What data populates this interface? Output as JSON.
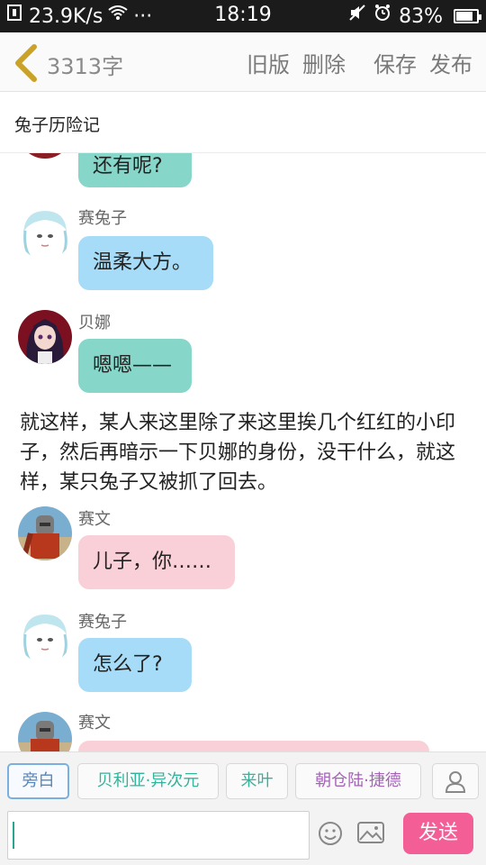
{
  "status_bar": {
    "net_speed": "23.9K/s",
    "dots": "···",
    "time": "18:19",
    "battery": "83%",
    "battery_level": 0.83
  },
  "toolbar": {
    "word_count": "3313字",
    "old_version": "旧版",
    "delete": "删除",
    "save": "保存",
    "publish": "发布"
  },
  "story": {
    "title": "兔子历险记"
  },
  "messages": [
    {
      "type": "bubble",
      "speaker": "",
      "text": "还有呢?",
      "color": "#86d7c9"
    },
    {
      "type": "bubble",
      "speaker": "赛兔子",
      "text": "温柔大方。",
      "color": "#a6dcf8"
    },
    {
      "type": "bubble",
      "speaker": "贝娜",
      "text": "嗯嗯——",
      "color": "#86d7c9"
    },
    {
      "type": "narration",
      "text": "就这样，某人来这里除了来这里挨几个红红的小印子，然后再暗示一下贝娜的身份，没干什么，就这样，某只兔子又被抓了回去。"
    },
    {
      "type": "bubble",
      "speaker": "赛文",
      "text": "儿子，你……",
      "color": "#f9cfd8"
    },
    {
      "type": "bubble",
      "speaker": "赛兔子",
      "text": "怎么了?",
      "color": "#a6dcf8"
    },
    {
      "type": "bubble",
      "speaker": "赛文",
      "text": "",
      "color": "#f9cfd8"
    }
  ],
  "characters": [
    {
      "label": "旁白",
      "selected": true
    },
    {
      "label": "贝利亚·异次元",
      "selected": false
    },
    {
      "label": "来叶",
      "selected": false
    },
    {
      "label": "朝仓陆·捷德",
      "selected": false
    }
  ],
  "input": {
    "value": "",
    "send_label": "发送"
  },
  "icons": {
    "back": "chevron-left-icon",
    "emoji": "smiley-icon",
    "image": "image-icon",
    "user": "user-icon",
    "mute": "mute-icon",
    "alarm": "alarm-icon",
    "wifi": "wifi-icon"
  },
  "colors": {
    "bubble_green": "#86d7c9",
    "bubble_blue": "#a6dcf8",
    "bubble_pink": "#f9cfd8",
    "send": "#f25e95",
    "back_arrow": "#c9a227"
  }
}
